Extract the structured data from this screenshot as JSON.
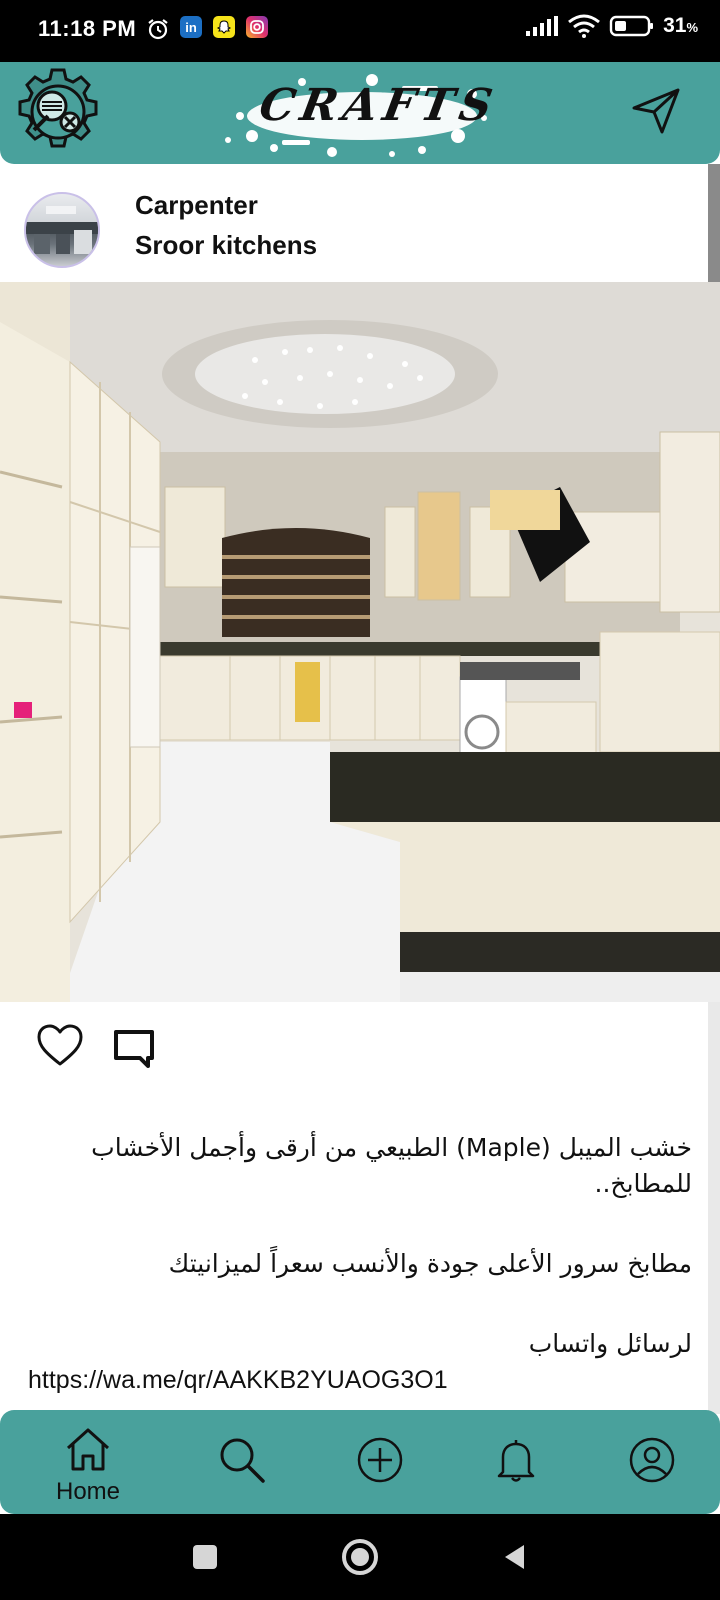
{
  "status_bar": {
    "time": "11:18 PM",
    "notification_icons": [
      "alarm-icon",
      "linkedin-icon",
      "snapchat-icon",
      "instagram-icon"
    ],
    "battery_percent": "31",
    "battery_unit": "%"
  },
  "header": {
    "brand": "CRAFTS",
    "colors": {
      "teal": "#49a19c"
    }
  },
  "post": {
    "author": {
      "role": "Carpenter",
      "name": "Sroor kitchens"
    },
    "caption": {
      "line1": "خشب الميبل (Maple) الطبيعي من أرقى وأجمل الأخشاب للمطابخ..",
      "line2": "مطابخ سرور الأعلى جودة والأنسب سعراً لميزانيتك",
      "line3": "لرسائل واتساب",
      "url": "https://wa.me/qr/AAKKB2YUAOG3O1"
    }
  },
  "bottom_nav": {
    "items": [
      {
        "label": "Home",
        "icon": "home-icon"
      },
      {
        "label": "",
        "icon": "search-icon"
      },
      {
        "label": "",
        "icon": "add-circle-icon"
      },
      {
        "label": "",
        "icon": "bell-icon"
      },
      {
        "label": "",
        "icon": "profile-icon"
      }
    ]
  }
}
